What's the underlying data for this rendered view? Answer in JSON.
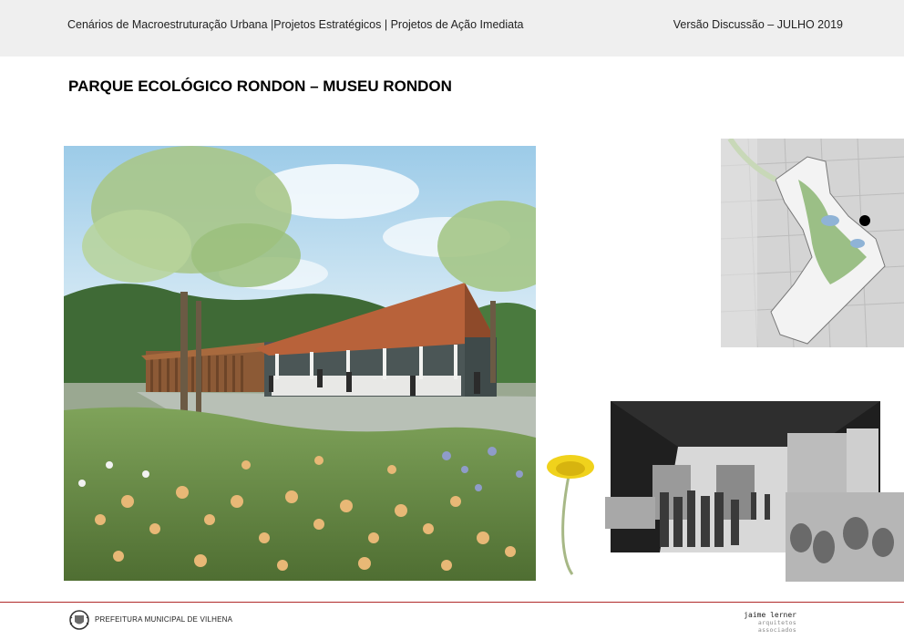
{
  "header": {
    "left_text": "Cenários de Macroestruturação Urbana |Projetos Estratégicos | Projetos de Ação Imediata",
    "right_text": "Versão Discussão – JULHO 2019"
  },
  "page": {
    "title": "PARQUE ECOLÓGICO RONDON – MUSEU RONDON"
  },
  "footer": {
    "org_name": "PREFEITURA MUNICIPAL DE VILHENA",
    "firm_name": "jaime lerner",
    "firm_subtitle": "arquitetos associados"
  },
  "colors": {
    "header_bg": "#efefef",
    "footer_rule": "#b02a2a",
    "roof": "#b8623a",
    "sky": "#bfe0f2"
  }
}
